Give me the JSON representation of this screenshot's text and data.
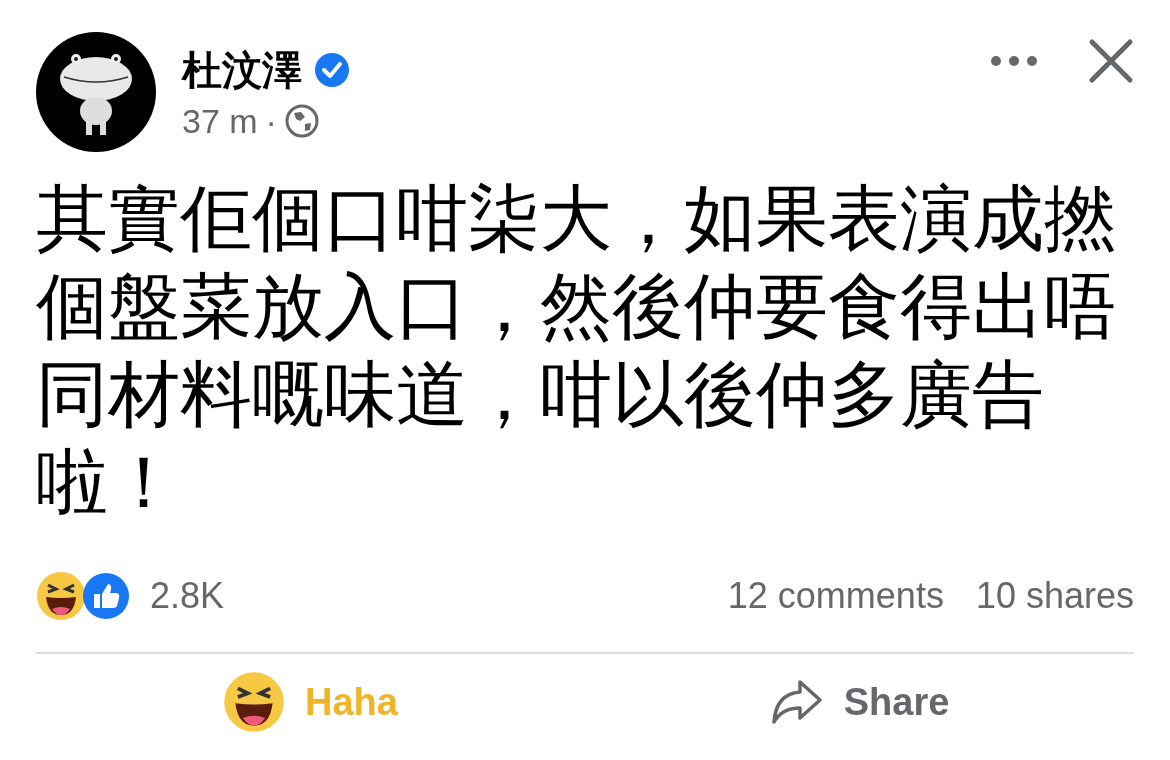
{
  "post": {
    "author": "杜汶澤",
    "verified": true,
    "time": "37 m",
    "separator": "·",
    "text": "其實佢個口咁柒大，如果表演成撚個盤菜放入口，然後仲要食得出唔同材料嘅味道，咁以後仲多廣告啦！"
  },
  "stats": {
    "reactions_count": "2.8K",
    "comments": "12 comments",
    "shares": "10 shares"
  },
  "actions": [
    {
      "kind": "reaction",
      "label": "Haha",
      "selected": true
    },
    {
      "kind": "share",
      "label": "Share",
      "selected": false
    }
  ]
}
